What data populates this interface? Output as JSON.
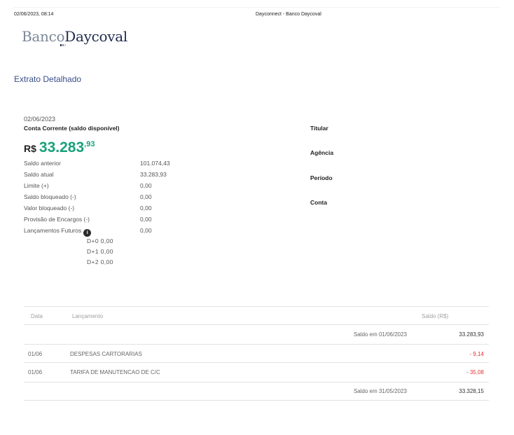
{
  "print_header": {
    "datetime": "02/06/2023, 08:14",
    "title": "Dayconnect - Banco Daycoval"
  },
  "logo": {
    "part1": "Banco",
    "part2": "Daycoval",
    "mark_colors": [
      "#1f2b4d",
      "#7d8799",
      "#c5cad6"
    ]
  },
  "section_title": "Extrato Detalhado",
  "summary": {
    "date": "02/06/2023",
    "account_type": "Conta Corrente (saldo disponível)",
    "balance_currency": "R$",
    "balance_int": "33.283",
    "balance_dec": ",93",
    "rows": [
      {
        "label": "Saldo anterior",
        "value": "101.074,43"
      },
      {
        "label": "Saldo atual",
        "value": "33.283,93"
      },
      {
        "label": "Limite (+)",
        "value": "0,00"
      },
      {
        "label": "Saldo bloqueado (-)",
        "value": "0,00"
      },
      {
        "label": "Valor bloqueado (-)",
        "value": "0,00"
      },
      {
        "label": "Provisão de Encargos (-)",
        "value": "0,00"
      },
      {
        "label": "Lançamentos Futuros",
        "value": "0,00"
      }
    ],
    "future": [
      "D+0 0,00",
      "D+1 0,00",
      "D+2 0,00"
    ]
  },
  "details": {
    "labels": [
      "Titular",
      "Agência",
      "Período",
      "Conta"
    ]
  },
  "table": {
    "headers": {
      "date": "Data",
      "entry": "Lançamento",
      "balance": "Saldo (R$)"
    },
    "rows": [
      {
        "date": "",
        "entry": "",
        "label": "Saldo em 01/06/2023",
        "amount": "33.283,93",
        "kind": "balance"
      },
      {
        "date": "01/06",
        "entry": "DESPESAS CARTORARIAS",
        "label": "",
        "amount": "- 9,14",
        "kind": "debit"
      },
      {
        "date": "01/06",
        "entry": "TARIFA DE MANUTENCAO DE C/C",
        "label": "",
        "amount": "- 35,08",
        "kind": "debit"
      },
      {
        "date": "",
        "entry": "",
        "label": "Saldo em 31/05/2023",
        "amount": "33.328,15",
        "kind": "balance"
      }
    ]
  },
  "colors": {
    "accent_green": "#1aa17a",
    "negative_red": "#e4312f",
    "title_blue": "#3a4f8a"
  }
}
